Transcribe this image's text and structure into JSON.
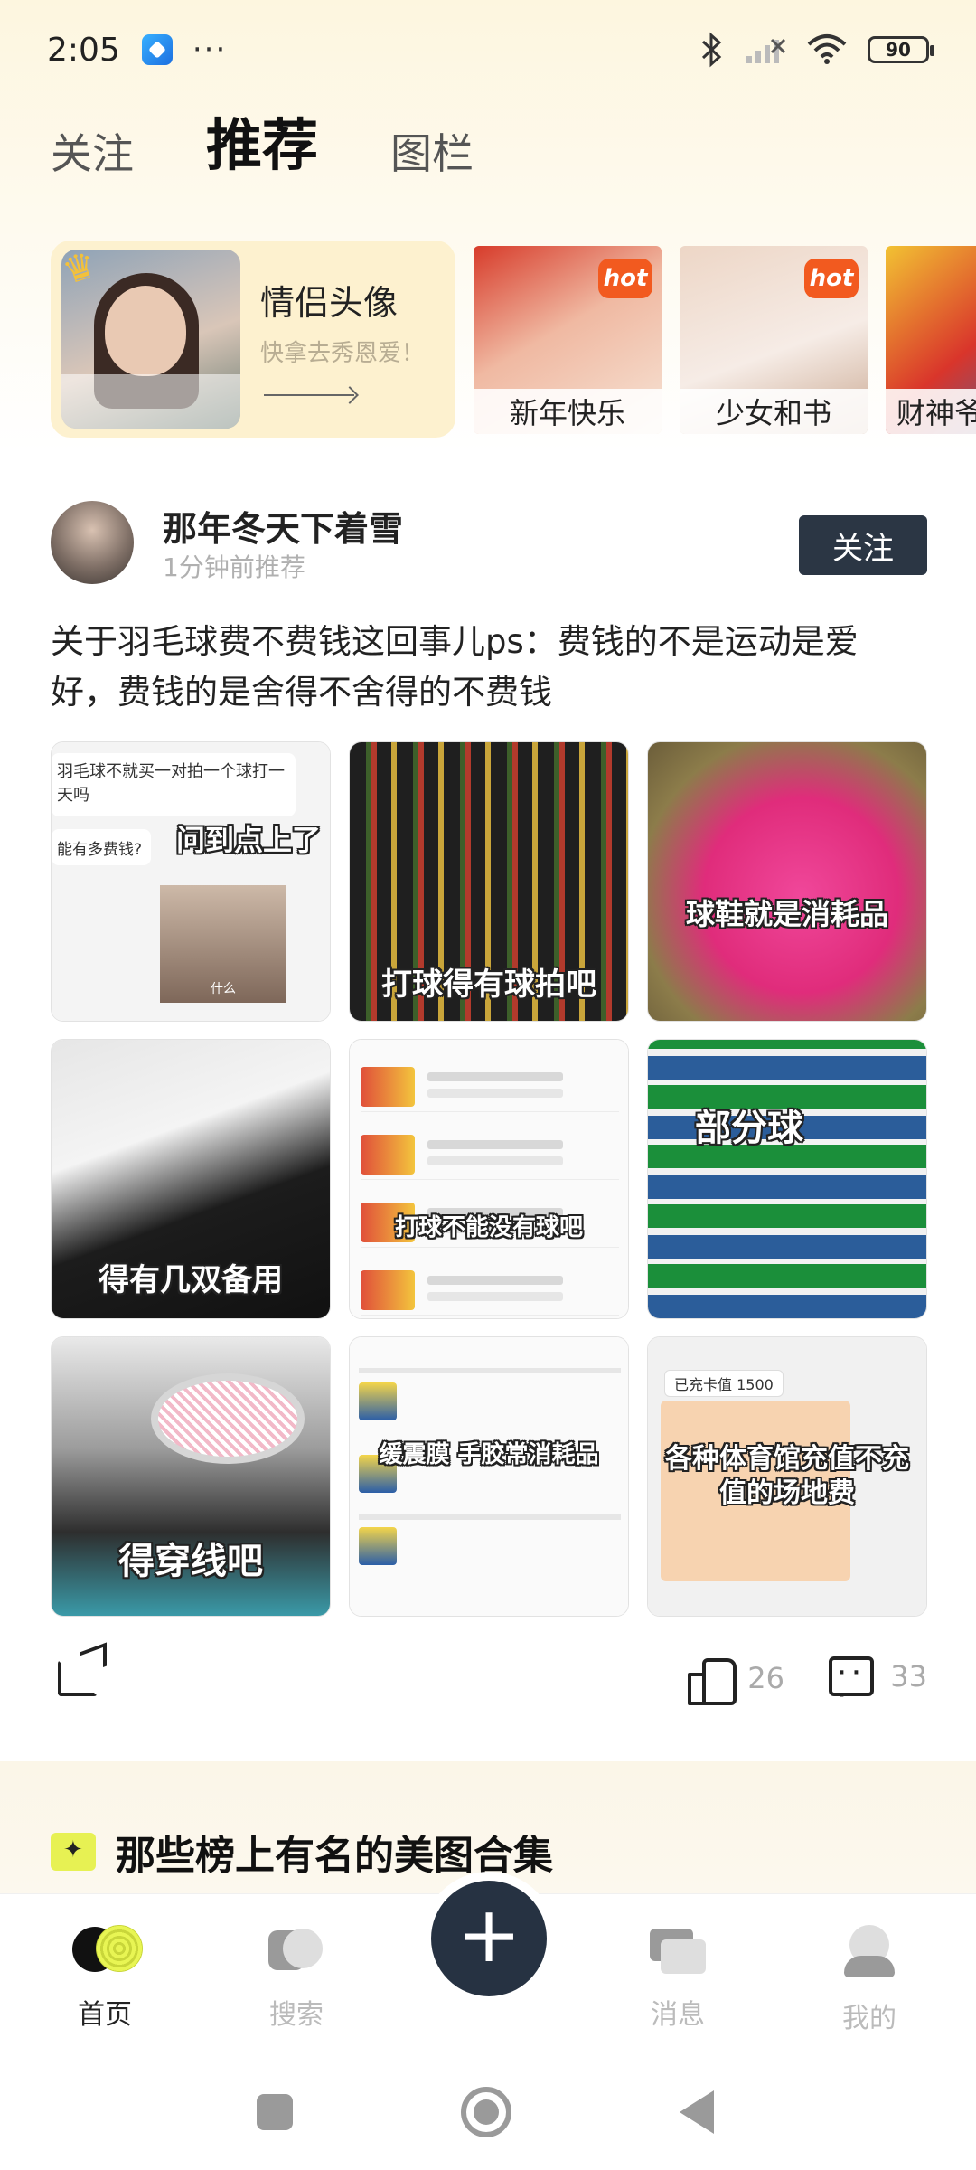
{
  "status_bar": {
    "time": "2:05",
    "dots": "···",
    "battery": "90"
  },
  "top_tabs": [
    {
      "label": "关注"
    },
    {
      "label": "推荐"
    },
    {
      "label": "图栏"
    }
  ],
  "feature_card": {
    "title": "情侣头像",
    "subtitle": "快拿去秀恩爱！"
  },
  "topics": [
    {
      "label": "新年快乐",
      "badge": "hot"
    },
    {
      "label": "少女和书",
      "badge": "hot"
    },
    {
      "label": "财神爷"
    }
  ],
  "post": {
    "author": "那年冬天下着雪",
    "time": "1分钟前推荐",
    "follow_label": "关注",
    "text": "关于羽毛球费不费钱这回事儿ps：费钱的不是运动是爱好，费钱的是舍得不舍得的不费钱",
    "images": [
      {
        "caption": "问到点上了",
        "chat1": "羽毛球不就买一对拍一个球打一天吗",
        "chat2": "能有多费钱?",
        "photo_text": "什么"
      },
      {
        "caption": "打球得有球拍吧"
      },
      {
        "caption": "球鞋就是消耗品"
      },
      {
        "caption": "得有几双备用"
      },
      {
        "caption": "打球不能没有球吧"
      },
      {
        "caption": "部分球"
      },
      {
        "caption": "得穿线吧"
      },
      {
        "caption": "缓震膜 手胶常消耗品"
      },
      {
        "caption": "各种体育馆充值不充值的场地费",
        "tag": "已充卡值 1500"
      }
    ],
    "likes": "26",
    "comments": "33"
  },
  "collection": {
    "title": "那些榜上有名的美图合集"
  },
  "bottom_nav": [
    {
      "label": "首页",
      "icon": "home-icon"
    },
    {
      "label": "搜索",
      "icon": "search-icon"
    },
    {
      "label": "消息",
      "icon": "message-icon"
    },
    {
      "label": "我的",
      "icon": "profile-icon"
    }
  ],
  "colors": {
    "accent": "#e8f553",
    "dark": "#263242",
    "feature_bg": "#fdf1cf"
  }
}
